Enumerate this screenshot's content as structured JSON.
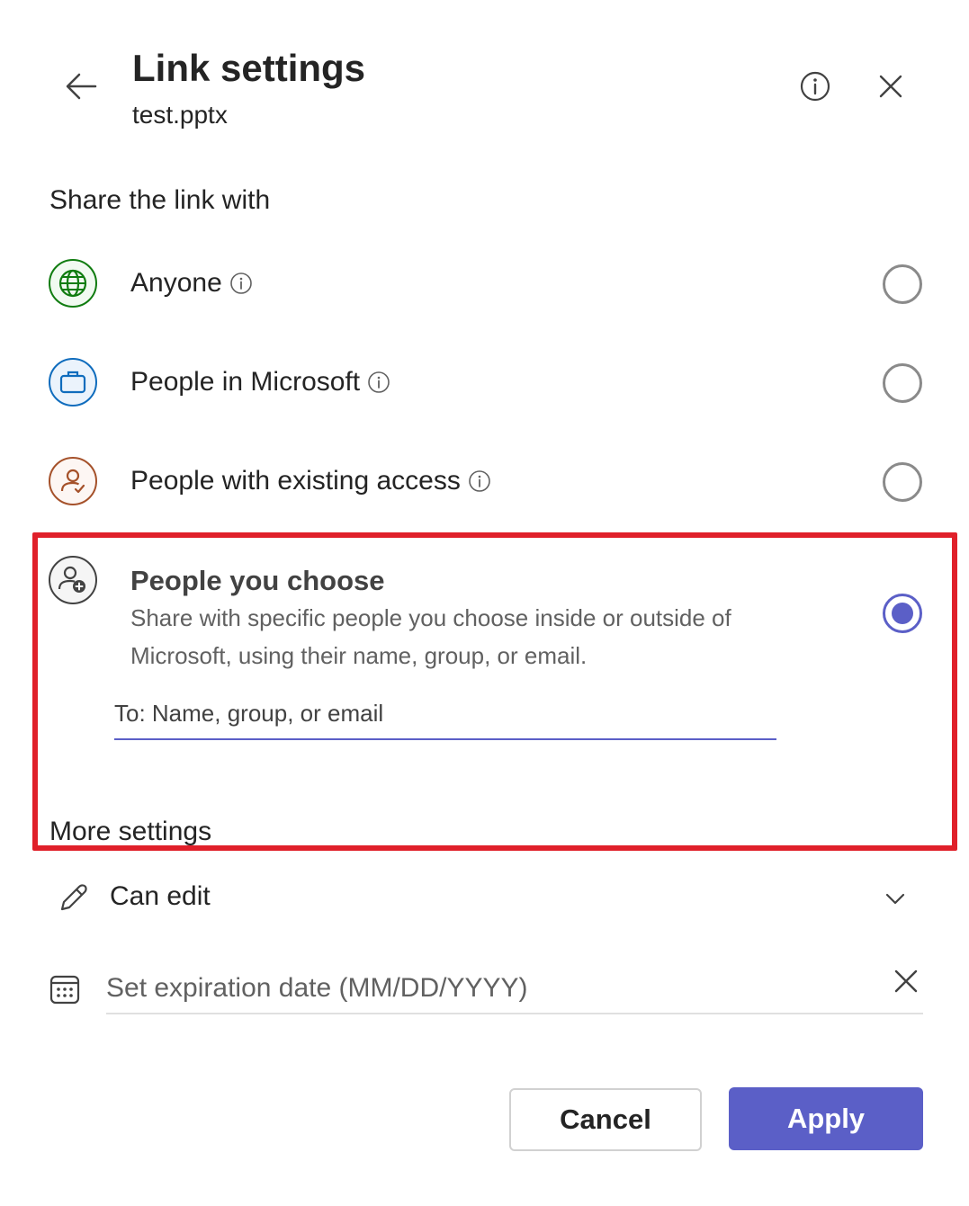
{
  "header": {
    "title": "Link settings",
    "filename": "test.pptx",
    "back_icon": "arrow-left-icon",
    "info_icon": "info-icon",
    "close_icon": "close-icon"
  },
  "share": {
    "heading": "Share the link with",
    "options": [
      {
        "label": "Anyone",
        "icon": "globe-icon",
        "color": "#107c10",
        "selected": false
      },
      {
        "label": "People in Microsoft",
        "icon": "briefcase-icon",
        "color": "#0f6cbd",
        "selected": false
      },
      {
        "label": "People with existing access",
        "icon": "person-check-icon",
        "color": "#a5512a",
        "selected": false
      },
      {
        "label": "People you choose",
        "icon": "person-add-icon",
        "color": "#424242",
        "selected": true,
        "description": "Share with specific people you choose inside or outside of Microsoft, using their name, group, or email."
      }
    ],
    "recipient_placeholder": "To: Name, group, or email"
  },
  "more_settings": {
    "heading": "More settings",
    "permission": "Can edit",
    "expiration_placeholder": "Set expiration date (MM/DD/YYYY)"
  },
  "footer": {
    "cancel_label": "Cancel",
    "apply_label": "Apply"
  },
  "colors": {
    "accent": "#5b5fc7",
    "highlight": "#e0202a"
  }
}
